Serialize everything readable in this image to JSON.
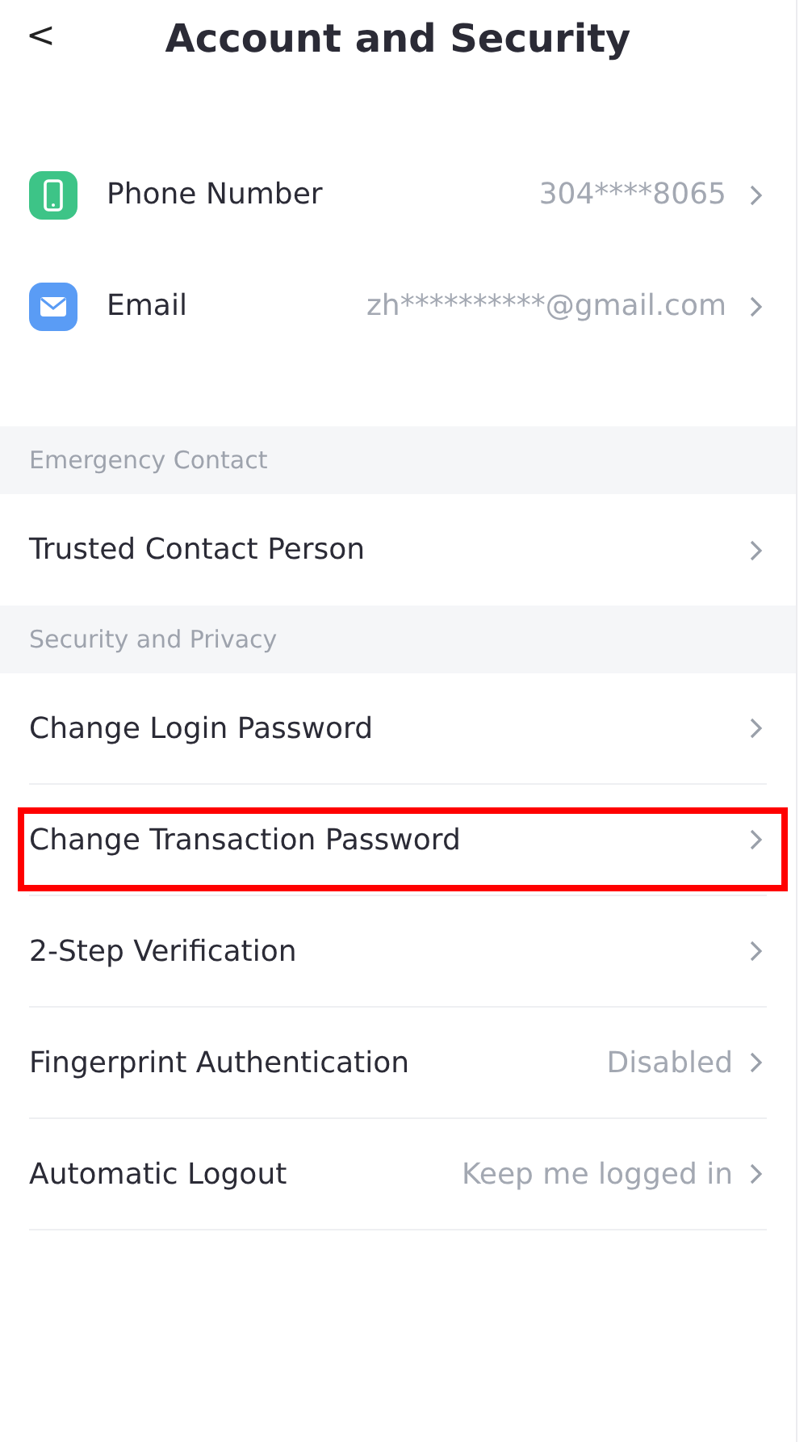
{
  "header": {
    "back": "<",
    "title": "Account and Security"
  },
  "accounts": [
    {
      "kind": "phone",
      "label": "Phone Number",
      "value": "304****8065"
    },
    {
      "kind": "email",
      "label": "Email",
      "value": "zh**********@gmail.com"
    }
  ],
  "sections": [
    {
      "title": "Emergency Contact",
      "items": [
        {
          "label": "Trusted Contact Person",
          "highlighted": false
        }
      ]
    },
    {
      "title": "Security and Privacy",
      "items": [
        {
          "label": "Change Login Password",
          "highlighted": false
        },
        {
          "label": "Change Transaction Password",
          "highlighted": true
        },
        {
          "label": "2-Step Verification",
          "highlighted": false
        },
        {
          "label": "Fingerprint Authentication",
          "value": "Disabled",
          "highlighted": false
        },
        {
          "label": "Automatic Logout",
          "value": "Keep me logged in",
          "highlighted": false
        }
      ]
    }
  ]
}
